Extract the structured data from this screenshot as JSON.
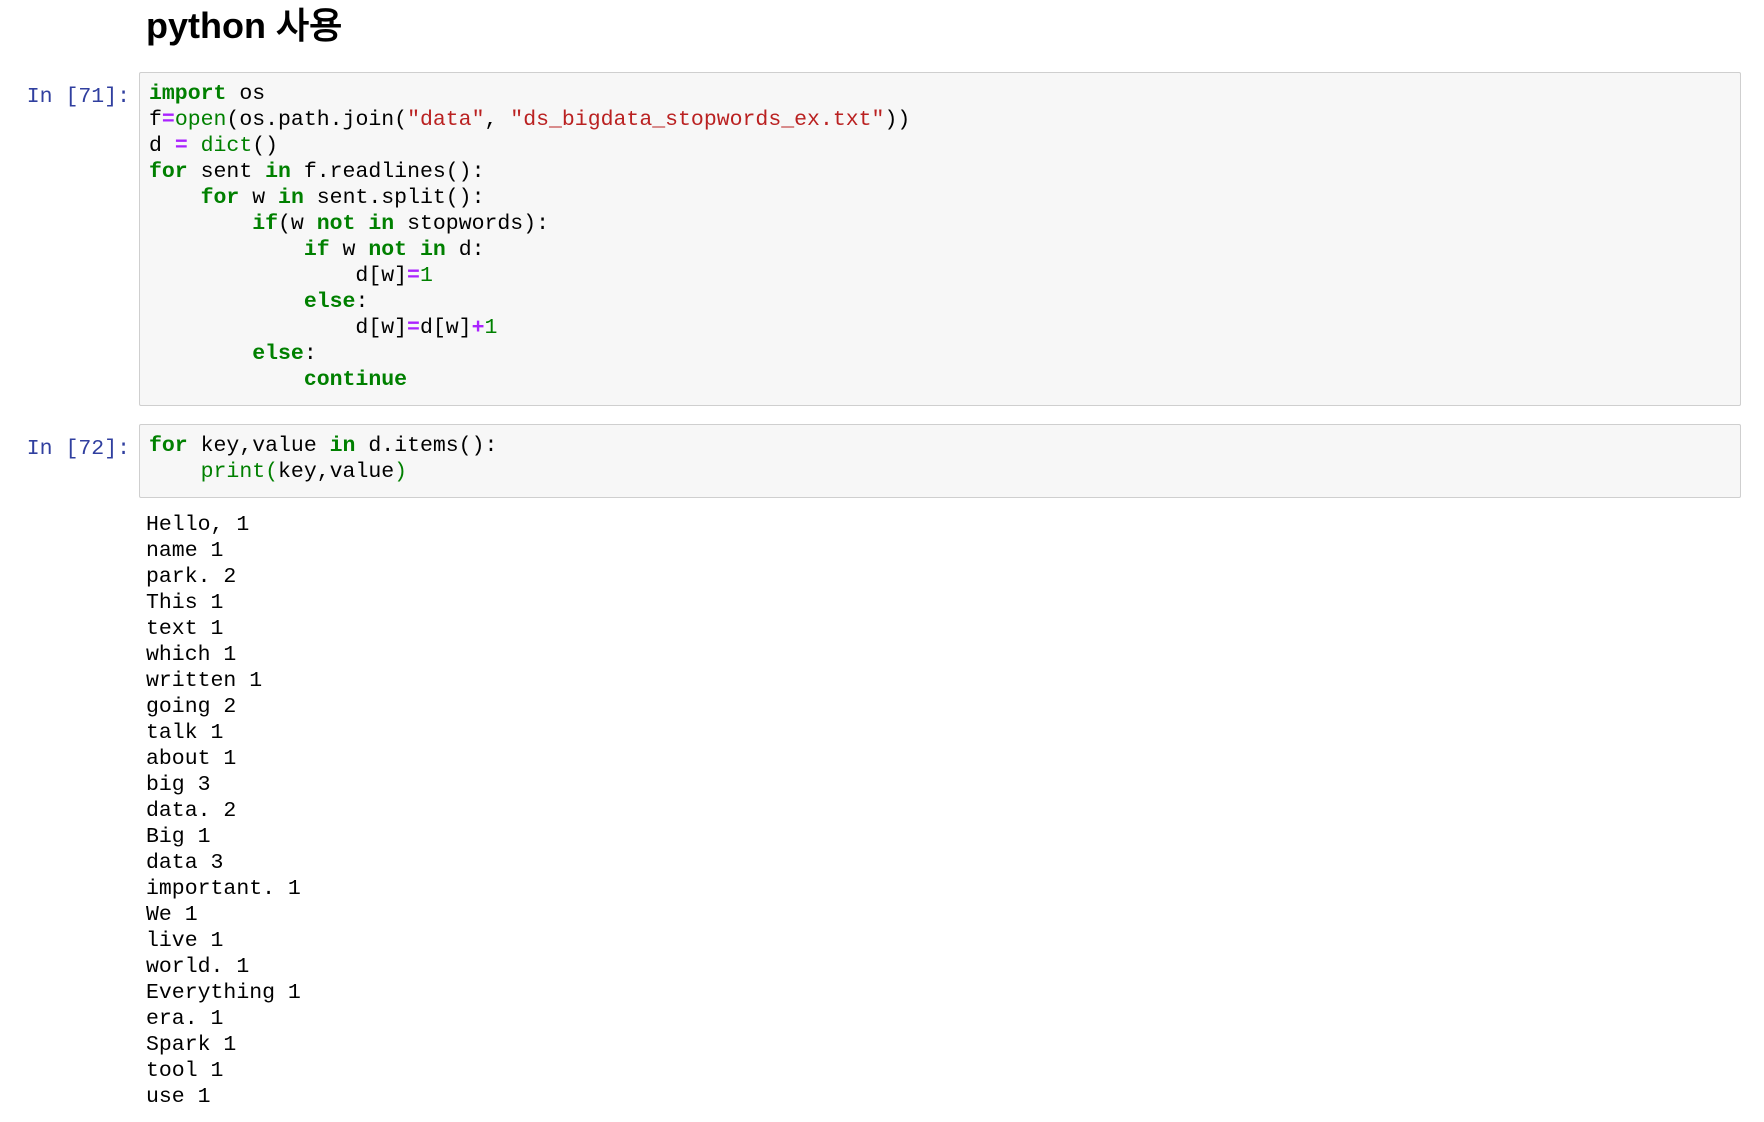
{
  "heading": "python 사용",
  "cells": [
    {
      "prompt": "In [71]:",
      "lines": [
        [
          {
            "t": "import",
            "c": "kw"
          },
          {
            "t": " os",
            "c": ""
          }
        ],
        [
          {
            "t": "f",
            "c": ""
          },
          {
            "t": "=",
            "c": "op"
          },
          {
            "t": "open",
            "c": "bi"
          },
          {
            "t": "(os.path.join(",
            "c": ""
          },
          {
            "t": "\"data\"",
            "c": "st"
          },
          {
            "t": ", ",
            "c": ""
          },
          {
            "t": "\"ds_bigdata_stopwords_ex.txt\"",
            "c": "st"
          },
          {
            "t": "))",
            "c": ""
          }
        ],
        [
          {
            "t": "d ",
            "c": ""
          },
          {
            "t": "=",
            "c": "op"
          },
          {
            "t": " ",
            "c": ""
          },
          {
            "t": "dict",
            "c": "bi"
          },
          {
            "t": "()",
            "c": ""
          }
        ],
        [
          {
            "t": "for",
            "c": "kw"
          },
          {
            "t": " sent ",
            "c": ""
          },
          {
            "t": "in",
            "c": "kw"
          },
          {
            "t": " f.readlines():",
            "c": ""
          }
        ],
        [
          {
            "t": "    ",
            "c": ""
          },
          {
            "t": "for",
            "c": "kw"
          },
          {
            "t": " w ",
            "c": ""
          },
          {
            "t": "in",
            "c": "kw"
          },
          {
            "t": " sent.split():",
            "c": ""
          }
        ],
        [
          {
            "t": "        ",
            "c": ""
          },
          {
            "t": "if",
            "c": "kw"
          },
          {
            "t": "(w ",
            "c": ""
          },
          {
            "t": "not",
            "c": "kw"
          },
          {
            "t": " ",
            "c": ""
          },
          {
            "t": "in",
            "c": "kw"
          },
          {
            "t": " stopwords):",
            "c": ""
          }
        ],
        [
          {
            "t": "            ",
            "c": ""
          },
          {
            "t": "if",
            "c": "kw"
          },
          {
            "t": " w ",
            "c": ""
          },
          {
            "t": "not",
            "c": "kw"
          },
          {
            "t": " ",
            "c": ""
          },
          {
            "t": "in",
            "c": "kw"
          },
          {
            "t": " d:",
            "c": ""
          }
        ],
        [
          {
            "t": "                d[w]",
            "c": ""
          },
          {
            "t": "=",
            "c": "op"
          },
          {
            "t": "1",
            "c": "nu"
          }
        ],
        [
          {
            "t": "            ",
            "c": ""
          },
          {
            "t": "else",
            "c": "kw"
          },
          {
            "t": ":",
            "c": ""
          }
        ],
        [
          {
            "t": "                d[w]",
            "c": ""
          },
          {
            "t": "=",
            "c": "op"
          },
          {
            "t": "d[w]",
            "c": ""
          },
          {
            "t": "+",
            "c": "op"
          },
          {
            "t": "1",
            "c": "nu"
          }
        ],
        [
          {
            "t": "        ",
            "c": ""
          },
          {
            "t": "else",
            "c": "kw"
          },
          {
            "t": ":",
            "c": ""
          }
        ],
        [
          {
            "t": "            ",
            "c": ""
          },
          {
            "t": "continue",
            "c": "kw"
          }
        ]
      ]
    },
    {
      "prompt": "In [72]:",
      "lines": [
        [
          {
            "t": "for",
            "c": "kw"
          },
          {
            "t": " key,value ",
            "c": ""
          },
          {
            "t": "in",
            "c": "kw"
          },
          {
            "t": " d.items():",
            "c": ""
          }
        ],
        [
          {
            "t": "    ",
            "c": ""
          },
          {
            "t": "print(",
            "c": "bi"
          },
          {
            "t": "key,value",
            "c": ""
          },
          {
            "t": ")",
            "c": "bi"
          }
        ]
      ]
    }
  ],
  "output_lines": [
    "Hello, 1",
    "name 1",
    "park. 2",
    "This 1",
    "text 1",
    "which 1",
    "written 1",
    "going 2",
    "talk 1",
    "about 1",
    "big 3",
    "data. 2",
    "Big 1",
    "data 3",
    "important. 1",
    "We 1",
    "live 1",
    "world. 1",
    "Everything 1",
    "era. 1",
    "Spark 1",
    "tool 1",
    "use 1"
  ]
}
